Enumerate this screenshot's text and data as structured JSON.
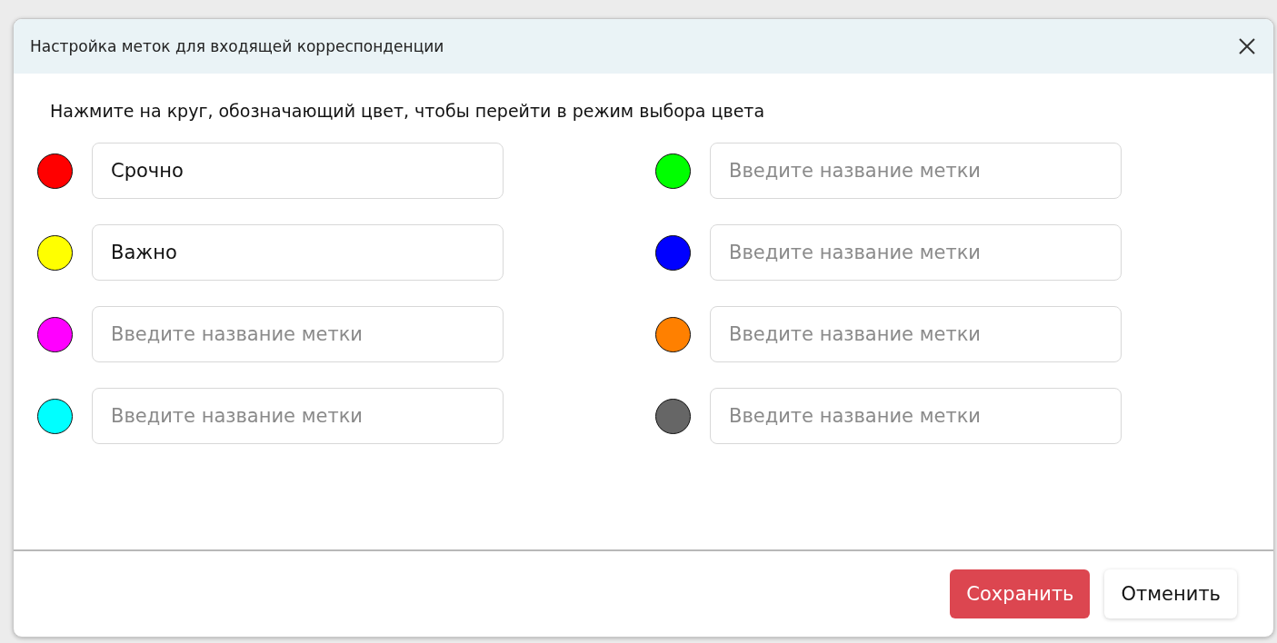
{
  "dialog": {
    "title": "Настройка меток для входящей корреспонденции"
  },
  "instruction": "Нажмите на круг, обозначающий цвет, чтобы перейти в режим выбора цвета",
  "labels": [
    {
      "color": "#ff0000",
      "value": "Срочно"
    },
    {
      "color": "#ffff00",
      "value": "Важно"
    },
    {
      "color": "#ff00ff",
      "placeholder": "Введите название метки"
    },
    {
      "color": "#00ffff",
      "placeholder": "Введите название метки"
    },
    {
      "color": "#00ff00",
      "placeholder": "Введите название метки"
    },
    {
      "color": "#0000ff",
      "placeholder": "Введите название метки"
    },
    {
      "color": "#ff8000",
      "placeholder": "Введите название метки"
    },
    {
      "color": "#666666",
      "placeholder": "Введите название метки"
    }
  ],
  "buttons": [
    {
      "label": "Сохранить",
      "kind": "primary"
    },
    {
      "label": "Отменить",
      "kind": "secondary"
    }
  ]
}
